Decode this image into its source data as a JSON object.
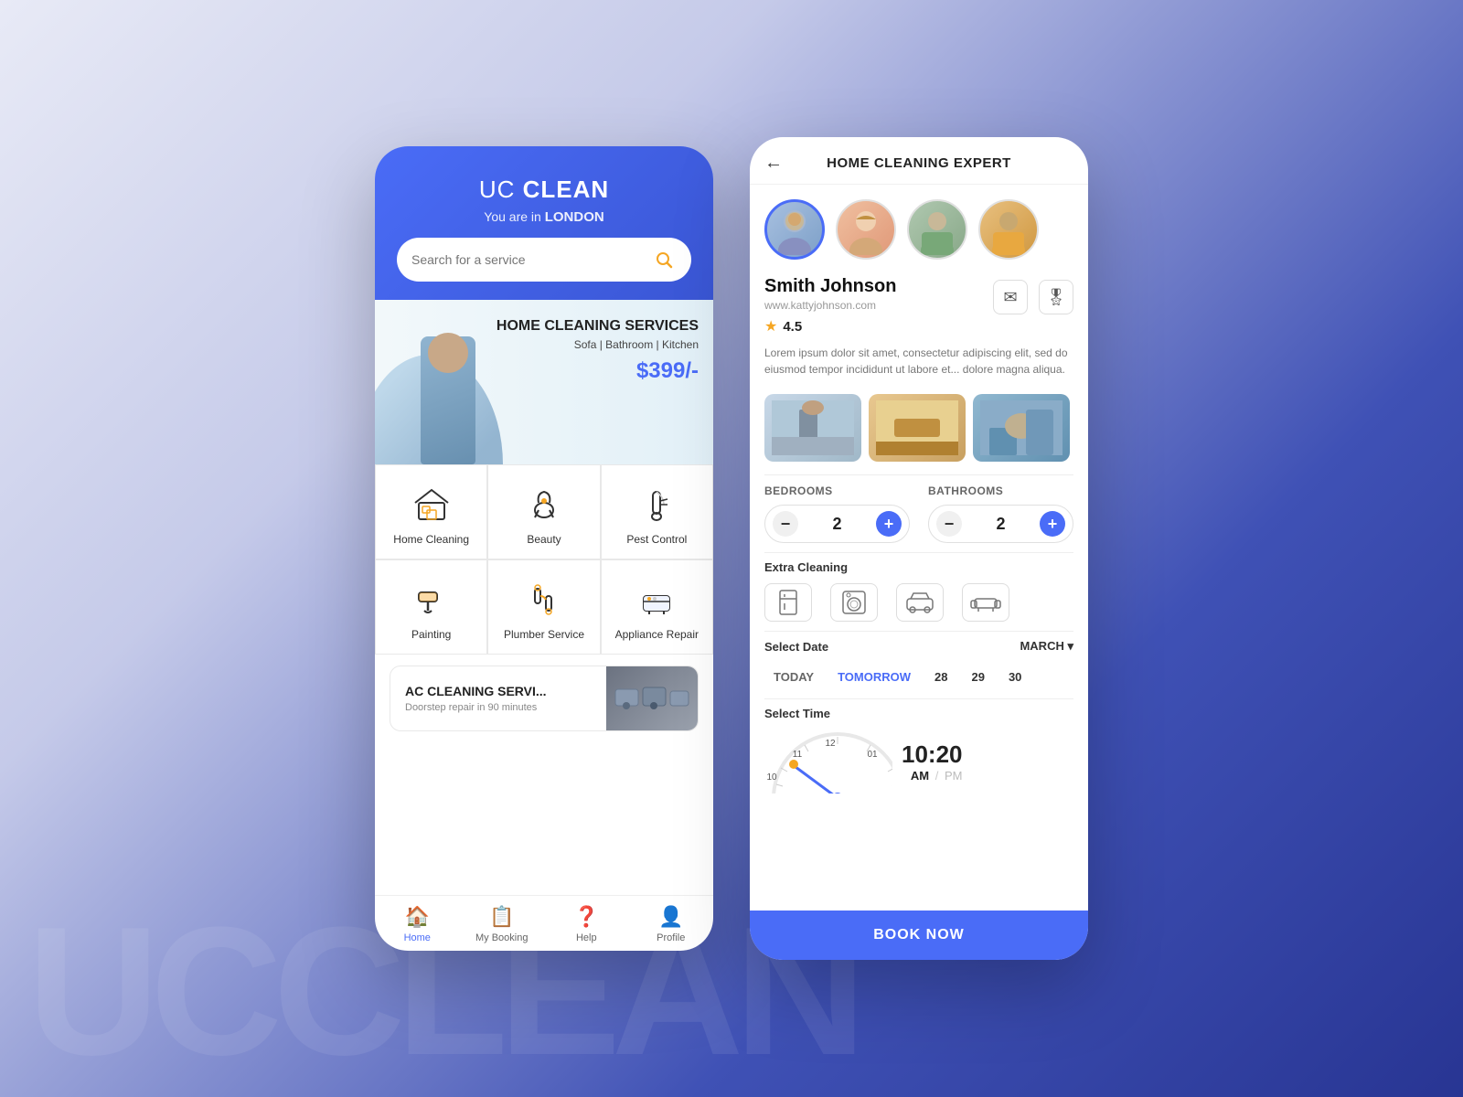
{
  "app": {
    "title_plain": "UC",
    "title_bold": "CLEAN",
    "location_prefix": "You are in",
    "location": "LONDON",
    "search_placeholder": "Search for a service"
  },
  "banner": {
    "title": "HOME CLEANING SERVICES",
    "subtitle": "Sofa | Bathroom | Kitchen",
    "price": "$399/-"
  },
  "services": [
    {
      "id": "home-cleaning",
      "label": "Home Cleaning",
      "icon": "🏠"
    },
    {
      "id": "beauty",
      "label": "Beauty",
      "icon": "💅"
    },
    {
      "id": "pest-control",
      "label": "Pest Control",
      "icon": "🧹"
    },
    {
      "id": "painting",
      "label": "Painting",
      "icon": "🖌️"
    },
    {
      "id": "plumber",
      "label": "Plumber Service",
      "icon": "🔧"
    },
    {
      "id": "appliance",
      "label": "Appliance Repair",
      "icon": "❄️"
    }
  ],
  "ac_card": {
    "title": "AC CLEANING SERVI...",
    "subtitle": "Doorstep repair in 90 minutes"
  },
  "nav": {
    "items": [
      {
        "id": "home",
        "label": "Home",
        "icon": "🏠",
        "active": true
      },
      {
        "id": "booking",
        "label": "My Booking",
        "icon": "📋",
        "active": false
      },
      {
        "id": "help",
        "label": "Help",
        "icon": "❓",
        "active": false
      },
      {
        "id": "profile",
        "label": "Profile",
        "icon": "👤",
        "active": false
      }
    ]
  },
  "detail": {
    "title": "HOME CLEANING EXPERT",
    "expert_name": "Smith Johnson",
    "expert_url": "www.kattyjohnson.com",
    "rating": "4.5",
    "description": "Lorem ipsum dolor sit amet, consectetur adipiscing elit, sed do eiusmod tempor incididunt ut labore et... dolore magna aliqua.",
    "bedrooms_label": "BEDROOMS",
    "bedrooms_count": "2",
    "bathrooms_label": "BATHROOMS",
    "bathrooms_count": "2",
    "extra_label": "Extra Cleaning",
    "select_date_label": "Select Date",
    "month": "MARCH",
    "date_today": "TODAY",
    "date_tomorrow": "TOMORROW",
    "date_28": "28",
    "date_29": "29",
    "date_30": "30",
    "select_time_label": "Select Time",
    "time": "10:20",
    "am": "AM",
    "pm": "PM",
    "book_btn": "BOOK NOW"
  },
  "watermark": "UCCLEAN"
}
